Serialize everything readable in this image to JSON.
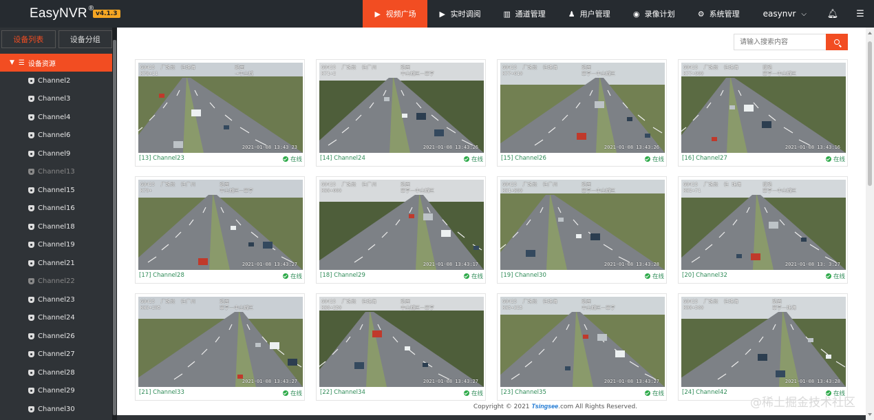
{
  "app": {
    "name": "EasyNVR",
    "trademark": "®",
    "version": "v4.1.3"
  },
  "nav": {
    "items": [
      {
        "label": "视频广场",
        "icon": "play-circle-icon",
        "active": true
      },
      {
        "label": "实时调阅",
        "icon": "video-icon",
        "active": false
      },
      {
        "label": "通道管理",
        "icon": "columns-icon",
        "active": false
      },
      {
        "label": "用户管理",
        "icon": "user-icon",
        "active": false
      },
      {
        "label": "录像计划",
        "icon": "reel-icon",
        "active": false
      },
      {
        "label": "系统管理",
        "icon": "gear-icon",
        "active": false
      }
    ],
    "user": "easynvr",
    "bell_icon": "bell-icon",
    "menu_icon": "hamburger-icon"
  },
  "sidebar": {
    "tabs": [
      "设备列表",
      "设备分组"
    ],
    "active_tab": 0,
    "root_label": "设备资源",
    "channels": [
      {
        "label": "Channel2",
        "online": true
      },
      {
        "label": "Channel3",
        "online": true
      },
      {
        "label": "Channel4",
        "online": true
      },
      {
        "label": "Channel6",
        "online": true
      },
      {
        "label": "Channel9",
        "online": true
      },
      {
        "label": "Channel13",
        "online": false
      },
      {
        "label": "Channel15",
        "online": true
      },
      {
        "label": "Channel16",
        "online": true
      },
      {
        "label": "Channel18",
        "online": true
      },
      {
        "label": "Channel19",
        "online": true
      },
      {
        "label": "Channel21",
        "online": true
      },
      {
        "label": "Channel22",
        "online": false
      },
      {
        "label": "Channel23",
        "online": true
      },
      {
        "label": "Channel24",
        "online": true
      },
      {
        "label": "Channel26",
        "online": true
      },
      {
        "label": "Channel27",
        "online": true
      },
      {
        "label": "Channel28",
        "online": true
      },
      {
        "label": "Channel29",
        "online": true
      },
      {
        "label": "Channel30",
        "online": true
      }
    ]
  },
  "search": {
    "placeholder": "请输入搜索内容"
  },
  "cards": [
    {
      "name": "[13] Channel23",
      "status": "在线",
      "id": "G0425  广珠段  往珠海\nK70+11",
      "loc": "路面\n→中山城",
      "ts": "2021-01-08 13:43 23"
    },
    {
      "name": "[14] Channel24",
      "status": "在线",
      "id": "G0425  广珠段  往广州\nK71+2",
      "loc": "路面\n中山城区—翠亨",
      "ts": "2021-01-08 13:43:26"
    },
    {
      "name": "[15] Channel26",
      "status": "在线",
      "id": "G0425  广珠段  往珠海\nK77+610",
      "loc": "路面\n翠亨—中山城区",
      "ts": "2021-01-08 13:43:26"
    },
    {
      "name": "[16] Channel27",
      "status": "在线",
      "id": "G0425  广珠段  往珠海\nK77+900",
      "loc": "道路\n翠亨—中山城区",
      "ts": "2021-01-08 13:43:16"
    },
    {
      "name": "[17] Channel28",
      "status": "在线",
      "id": "G0425  广珠段  往广州\nK79+",
      "loc": "路面\n中山城区—翠亨",
      "ts": "2021-01-08 13:43:27"
    },
    {
      "name": "[18] Channel29",
      "status": "在线",
      "id": "G0425  广珠段  往广州\nK80+000",
      "loc": "路面\n翠亨—中山城区",
      "ts": "2021-01-08 13:43:17"
    },
    {
      "name": "[19] Channel30",
      "status": "在线",
      "id": "G0425  广珠段  往广州\nK81+800",
      "loc": "路面\n翠亨—中山城区",
      "ts": "2021-01-08 13:43:28"
    },
    {
      "name": "[20] Channel32",
      "status": "在线",
      "id": "G0425  广珠段  往 珠海\nK82+71",
      "loc": "道路\n翠亨—中山城区",
      "ts": "2021-01-08 13: 3:27"
    },
    {
      "name": "[21] Channel33",
      "status": "在线",
      "id": "G0425  广珠段  往广州\nK83+295",
      "loc": "路面\n翠亨—中山城区",
      "ts": "2021-01-08 13:43:27"
    },
    {
      "name": "[22] Channel34",
      "status": "在线",
      "id": "G0425  广珠段  往珠海\nK86+250",
      "loc": "路面\n中山城区—翠亨",
      "ts": "2021-01-08 13:43:27"
    },
    {
      "name": "[23] Channel35",
      "status": "在线",
      "id": "G0425  广珠段  往珠海\nK85+325",
      "loc": "路面\n中山城区—翠亨",
      "ts": "2021-01-08 13:43:27"
    },
    {
      "name": "[24] Channel42",
      "status": "在线",
      "id": "G0425  广珠段  往珠海\nK90+560",
      "loc": "路面\n翠亨—珠海",
      "ts": "2021-01-08 13:43:28"
    }
  ],
  "footer": {
    "copyright": "Copyright © 2021",
    "logo": "Tsingsee",
    "rights": ".com All Rights Reserved."
  },
  "watermark": "@稀土掘金技术社区",
  "colors": {
    "accent": "#f24d22",
    "topbar": "#262b30",
    "sidebar": "#2f3337",
    "online": "#2e8b57",
    "version_badge": "#f5a623"
  }
}
